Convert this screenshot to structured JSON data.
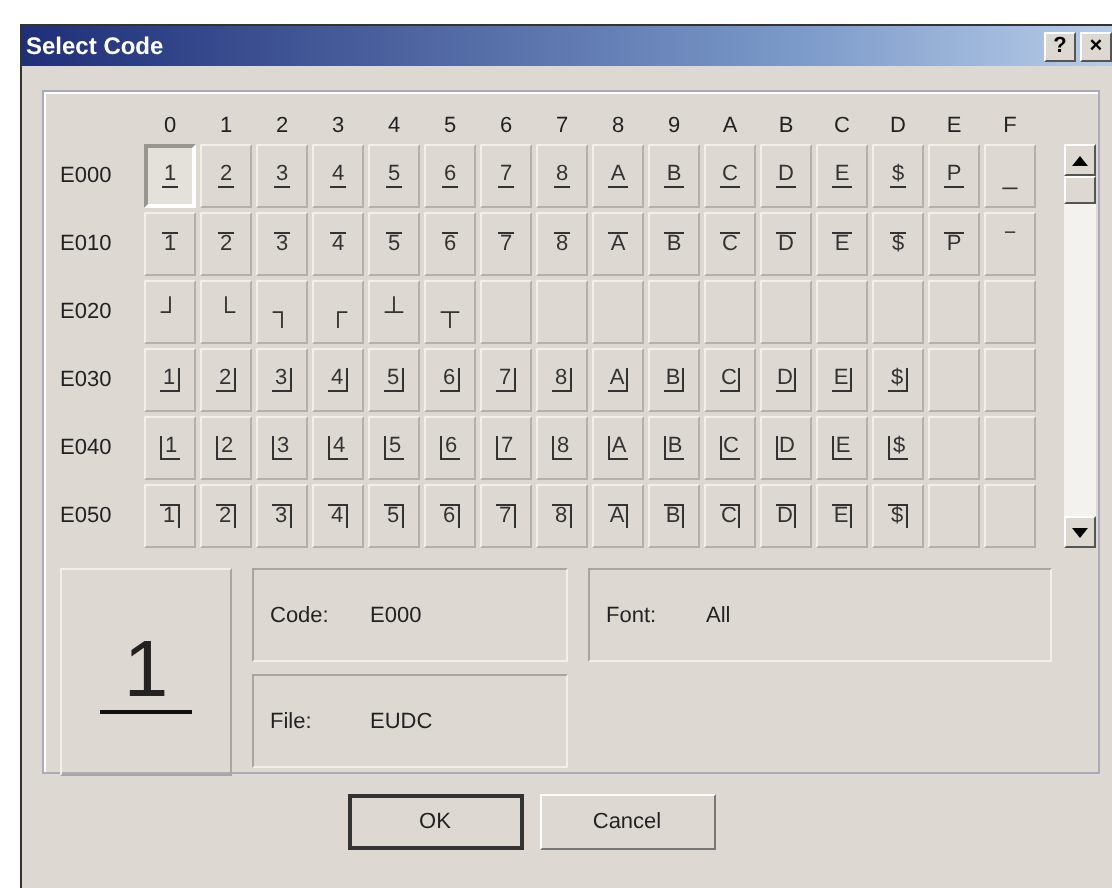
{
  "window": {
    "title": "Select Code",
    "help_button": "?",
    "close_button": "×"
  },
  "grid": {
    "columns": [
      "0",
      "1",
      "2",
      "3",
      "4",
      "5",
      "6",
      "7",
      "8",
      "9",
      "A",
      "B",
      "C",
      "D",
      "E",
      "F"
    ],
    "rows": [
      {
        "code": "E000",
        "kind": "under",
        "cells": [
          {
            "glyph": "1",
            "selected": true
          },
          {
            "glyph": "2",
            "selected": false
          },
          {
            "glyph": "3",
            "selected": false
          },
          {
            "glyph": "4",
            "selected": false
          },
          {
            "glyph": "5",
            "selected": false
          },
          {
            "glyph": "6",
            "selected": false
          },
          {
            "glyph": "7",
            "selected": false
          },
          {
            "glyph": "8",
            "selected": false
          },
          {
            "glyph": "A",
            "selected": false
          },
          {
            "glyph": "B",
            "selected": false
          },
          {
            "glyph": "C",
            "selected": false
          },
          {
            "glyph": "D",
            "selected": false
          },
          {
            "glyph": "E",
            "selected": false
          },
          {
            "glyph": "$",
            "selected": false
          },
          {
            "glyph": "P",
            "selected": false
          },
          {
            "glyph": "_",
            "selected": false,
            "kind": "plain"
          }
        ]
      },
      {
        "code": "E010",
        "kind": "over",
        "cells": [
          {
            "glyph": "1",
            "selected": false
          },
          {
            "glyph": "2",
            "selected": false
          },
          {
            "glyph": "3",
            "selected": false
          },
          {
            "glyph": "4",
            "selected": false
          },
          {
            "glyph": "5",
            "selected": false
          },
          {
            "glyph": "6",
            "selected": false
          },
          {
            "glyph": "7",
            "selected": false
          },
          {
            "glyph": "8",
            "selected": false
          },
          {
            "glyph": "A",
            "selected": false
          },
          {
            "glyph": "B",
            "selected": false
          },
          {
            "glyph": "C",
            "selected": false
          },
          {
            "glyph": "D",
            "selected": false
          },
          {
            "glyph": "E",
            "selected": false
          },
          {
            "glyph": "$",
            "selected": false
          },
          {
            "glyph": "P",
            "selected": false
          },
          {
            "glyph": "‾",
            "selected": false,
            "kind": "plain"
          }
        ]
      },
      {
        "code": "E020",
        "kind": "plain",
        "cells": [
          {
            "glyph": "┘",
            "selected": false
          },
          {
            "glyph": "└",
            "selected": false
          },
          {
            "glyph": "┐",
            "selected": false
          },
          {
            "glyph": "┌",
            "selected": false
          },
          {
            "glyph": "┴",
            "selected": false
          },
          {
            "glyph": "┬",
            "selected": false
          }
        ]
      },
      {
        "code": "E030",
        "kind": "under-right",
        "cells": [
          {
            "glyph": "1",
            "selected": false
          },
          {
            "glyph": "2",
            "selected": false
          },
          {
            "glyph": "3",
            "selected": false
          },
          {
            "glyph": "4",
            "selected": false
          },
          {
            "glyph": "5",
            "selected": false
          },
          {
            "glyph": "6",
            "selected": false
          },
          {
            "glyph": "7",
            "selected": false
          },
          {
            "glyph": "8",
            "selected": false
          },
          {
            "glyph": "A",
            "selected": false
          },
          {
            "glyph": "B",
            "selected": false
          },
          {
            "glyph": "C",
            "selected": false
          },
          {
            "glyph": "D",
            "selected": false
          },
          {
            "glyph": "E",
            "selected": false
          },
          {
            "glyph": "$",
            "selected": false
          }
        ]
      },
      {
        "code": "E040",
        "kind": "left-under",
        "cells": [
          {
            "glyph": "1",
            "selected": false
          },
          {
            "glyph": "2",
            "selected": false
          },
          {
            "glyph": "3",
            "selected": false
          },
          {
            "glyph": "4",
            "selected": false
          },
          {
            "glyph": "5",
            "selected": false
          },
          {
            "glyph": "6",
            "selected": false
          },
          {
            "glyph": "7",
            "selected": false
          },
          {
            "glyph": "8",
            "selected": false
          },
          {
            "glyph": "A",
            "selected": false
          },
          {
            "glyph": "B",
            "selected": false
          },
          {
            "glyph": "C",
            "selected": false
          },
          {
            "glyph": "D",
            "selected": false
          },
          {
            "glyph": "E",
            "selected": false
          },
          {
            "glyph": "$",
            "selected": false
          }
        ]
      },
      {
        "code": "E050",
        "kind": "over-right",
        "cells": [
          {
            "glyph": "1",
            "selected": false
          },
          {
            "glyph": "2",
            "selected": false
          },
          {
            "glyph": "3",
            "selected": false
          },
          {
            "glyph": "4",
            "selected": false
          },
          {
            "glyph": "5",
            "selected": false
          },
          {
            "glyph": "6",
            "selected": false
          },
          {
            "glyph": "7",
            "selected": false
          },
          {
            "glyph": "8",
            "selected": false
          },
          {
            "glyph": "A",
            "selected": false
          },
          {
            "glyph": "B",
            "selected": false
          },
          {
            "glyph": "C",
            "selected": false
          },
          {
            "glyph": "D",
            "selected": false
          },
          {
            "glyph": "E",
            "selected": false
          },
          {
            "glyph": "$",
            "selected": false
          }
        ]
      }
    ]
  },
  "preview": {
    "glyph": "1",
    "kind": "under"
  },
  "info": {
    "code_label": "Code:",
    "code_value": "E000",
    "file_label": "File:",
    "file_value": "EUDC",
    "font_label": "Font:",
    "font_value": "All"
  },
  "buttons": [
    {
      "label": "OK",
      "default": true
    },
    {
      "label": "Cancel",
      "default": false
    }
  ]
}
